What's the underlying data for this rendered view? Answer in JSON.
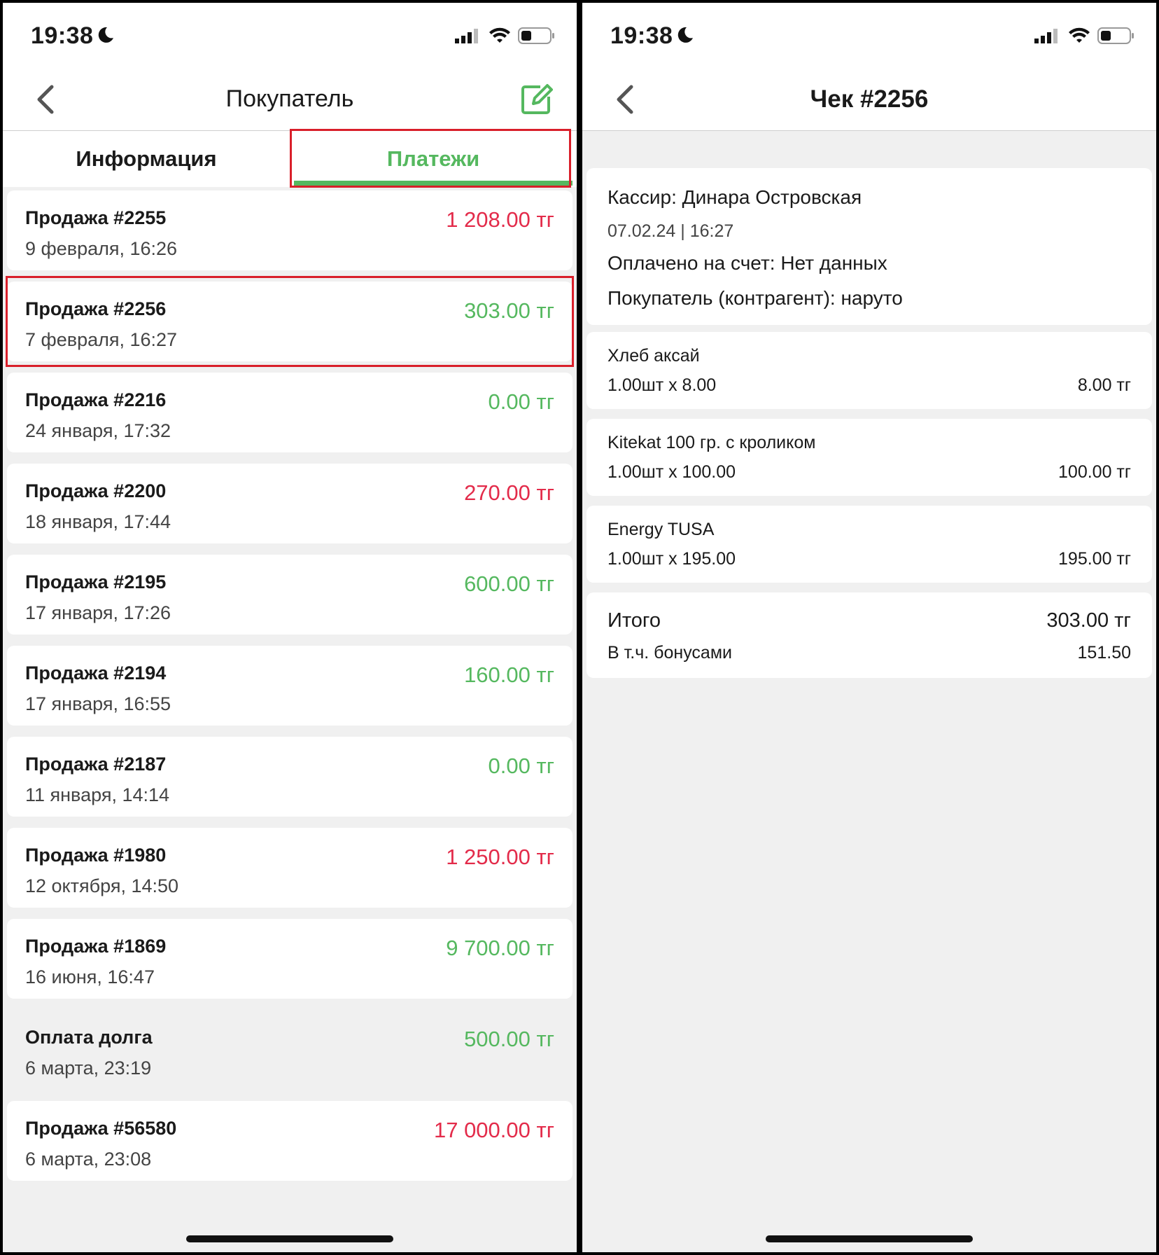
{
  "status_bar": {
    "time": "19:38"
  },
  "left_screen": {
    "title": "Покупатель",
    "tabs": [
      "Информация",
      "Платежи"
    ],
    "active_tab": "Платежи",
    "payments": [
      {
        "title": "Продажа #2255",
        "date": "9 февраля, 16:26",
        "amount": "1 208.00 тг",
        "status": "negative"
      },
      {
        "title": "Продажа #2256",
        "date": "7 февраля, 16:27",
        "amount": "303.00 тг",
        "status": "positive",
        "highlighted": true
      },
      {
        "title": "Продажа #2216",
        "date": "24 января, 17:32",
        "amount": "0.00 тг",
        "status": "positive"
      },
      {
        "title": "Продажа #2200",
        "date": "18 января, 17:44",
        "amount": "270.00 тг",
        "status": "negative"
      },
      {
        "title": "Продажа #2195",
        "date": "17 января, 17:26",
        "amount": "600.00 тг",
        "status": "positive"
      },
      {
        "title": "Продажа #2194",
        "date": "17 января, 16:55",
        "amount": "160.00 тг",
        "status": "positive"
      },
      {
        "title": "Продажа #2187",
        "date": "11 января, 14:14",
        "amount": "0.00 тг",
        "status": "positive"
      },
      {
        "title": "Продажа #1980",
        "date": "12 октября, 14:50",
        "amount": "1 250.00 тг",
        "status": "negative"
      },
      {
        "title": "Продажа #1869",
        "date": "16 июня, 16:47",
        "amount": "9 700.00 тг",
        "status": "positive"
      },
      {
        "title": "Оплата долга",
        "date": "6 марта, 23:19",
        "amount": "500.00 тг",
        "status": "positive",
        "plain": true
      },
      {
        "title": "Продажа #56580",
        "date": "6 марта, 23:08",
        "amount": "17 000.00 тг",
        "status": "negative"
      }
    ]
  },
  "right_screen": {
    "title": "Чек #2256",
    "cashier": "Кассир: Динара Островская",
    "datetime": "07.02.24 | 16:27",
    "paid_to": "Оплачено на счет: Нет данных",
    "buyer": "Покупатель (контрагент): наруто",
    "items": [
      {
        "name": "Хлеб аксай",
        "qty": "1.00шт x 8.00",
        "price": "8.00 тг"
      },
      {
        "name": "Kitekat 100 гр. с кроликом",
        "qty": "1.00шт x 100.00",
        "price": "100.00 тг"
      },
      {
        "name": "Energy TUSA",
        "qty": "1.00шт x 195.00",
        "price": "195.00 тг"
      }
    ],
    "total_label": "Итого",
    "total_value": "303.00 тг",
    "bonus_label": "В т.ч. бонусами",
    "bonus_value": "151.50"
  },
  "colors": {
    "accent_green": "#55b85f",
    "negative_red": "#e32b4a",
    "highlight_red": "#d91f2a"
  }
}
